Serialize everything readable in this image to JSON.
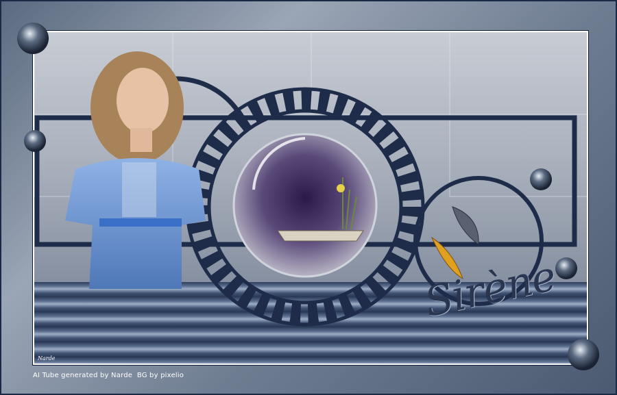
{
  "artwork": {
    "title_text": "Sirène",
    "signature": "Narde",
    "credit_line": "AI Tube generated by Narde  BG by pixelio"
  },
  "colors": {
    "frame_navy": "#1b2a44",
    "ring_navy": "#1e2c4a",
    "dress_blue": "#6f98d6",
    "water_dark": "#2b3b59"
  }
}
